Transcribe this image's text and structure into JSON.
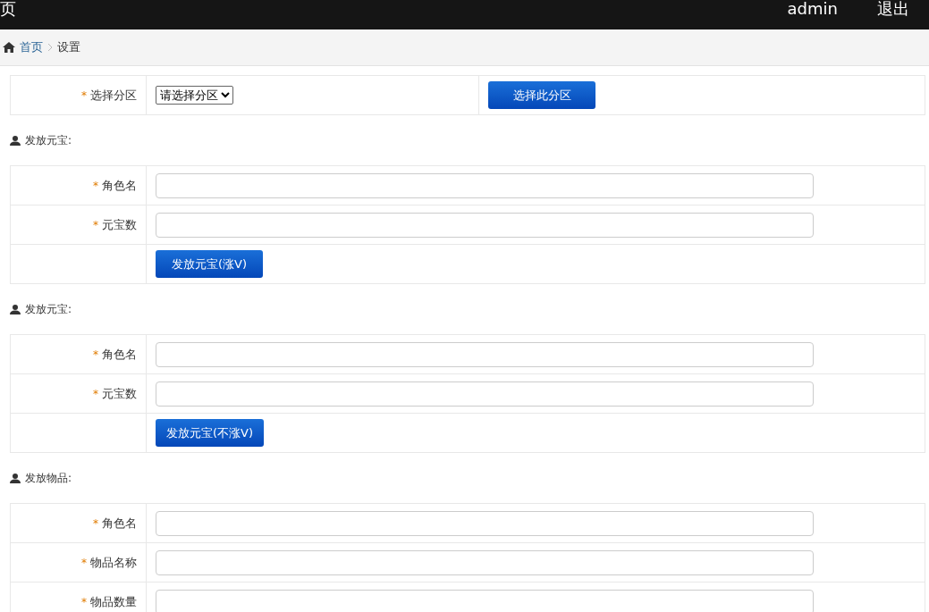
{
  "topbar": {
    "title": "页",
    "user": "admin",
    "logout": "退出"
  },
  "breadcrumb": {
    "home": "首页",
    "current": "设置"
  },
  "server_select": {
    "mark": "*",
    "label": "选择分区",
    "select_value": "请选择分区",
    "button": "选择此分区"
  },
  "sections": [
    {
      "title": "发放元宝:",
      "rows": [
        {
          "kind": "input",
          "mark": "*",
          "label": "角色名"
        },
        {
          "kind": "input",
          "mark": "*",
          "label": "元宝数"
        },
        {
          "kind": "button",
          "button": "发放元宝(涨V)"
        }
      ]
    },
    {
      "title": "发放元宝:",
      "rows": [
        {
          "kind": "input",
          "mark": "*",
          "label": "角色名"
        },
        {
          "kind": "input",
          "mark": "*",
          "label": "元宝数"
        },
        {
          "kind": "button",
          "button": "发放元宝(不涨V)"
        }
      ]
    },
    {
      "title": "发放物品:",
      "rows": [
        {
          "kind": "input",
          "mark": "*",
          "label": "角色名"
        },
        {
          "kind": "input",
          "mark": "*",
          "label": "物品名称"
        },
        {
          "kind": "input",
          "mark": "*",
          "label": "物品数量"
        }
      ]
    }
  ]
}
